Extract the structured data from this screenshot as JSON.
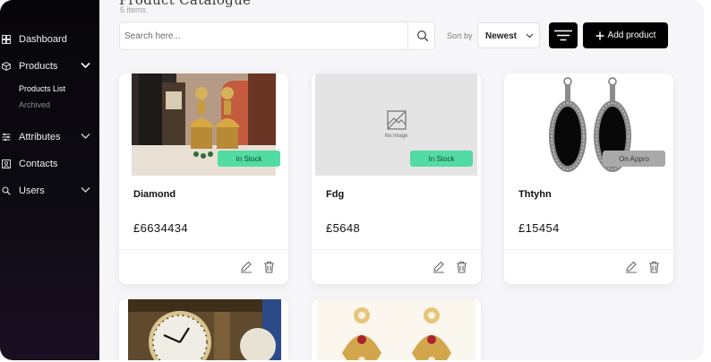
{
  "header": {
    "title": "Product Catalogue",
    "item_count": "5 items"
  },
  "sidebar": {
    "items": [
      {
        "label": "Dashboard",
        "icon": "dashboard-icon"
      },
      {
        "label": "Products",
        "icon": "box-icon",
        "expanded": true
      },
      {
        "label": "Attributes",
        "icon": "sliders-icon"
      },
      {
        "label": "Contacts",
        "icon": "contacts-icon"
      },
      {
        "label": "Users",
        "icon": "search-user-icon"
      }
    ],
    "sub_items": [
      {
        "label": "Products List",
        "active": true
      },
      {
        "label": "Archived",
        "active": false
      }
    ]
  },
  "toolbar": {
    "search_placeholder": "Search here...",
    "sort_label": "Sort by",
    "sort_value": "Newest",
    "add_label": "Add product"
  },
  "products": [
    {
      "name": "Diamond",
      "price": "£6634434",
      "badge": "In Stock",
      "badge_type": "stock"
    },
    {
      "name": "Fdg",
      "price": "£5648",
      "badge": "In Stock",
      "badge_type": "stock",
      "no_image_text": "No Image"
    },
    {
      "name": "Thtyhn",
      "price": "£15454",
      "badge": "On Appro",
      "badge_type": "appro"
    }
  ],
  "colors": {
    "in_stock": "#52dba2",
    "on_appro": "#a9a9a9",
    "sidebar_bg": "#0a090e",
    "primary_btn": "#000000"
  }
}
